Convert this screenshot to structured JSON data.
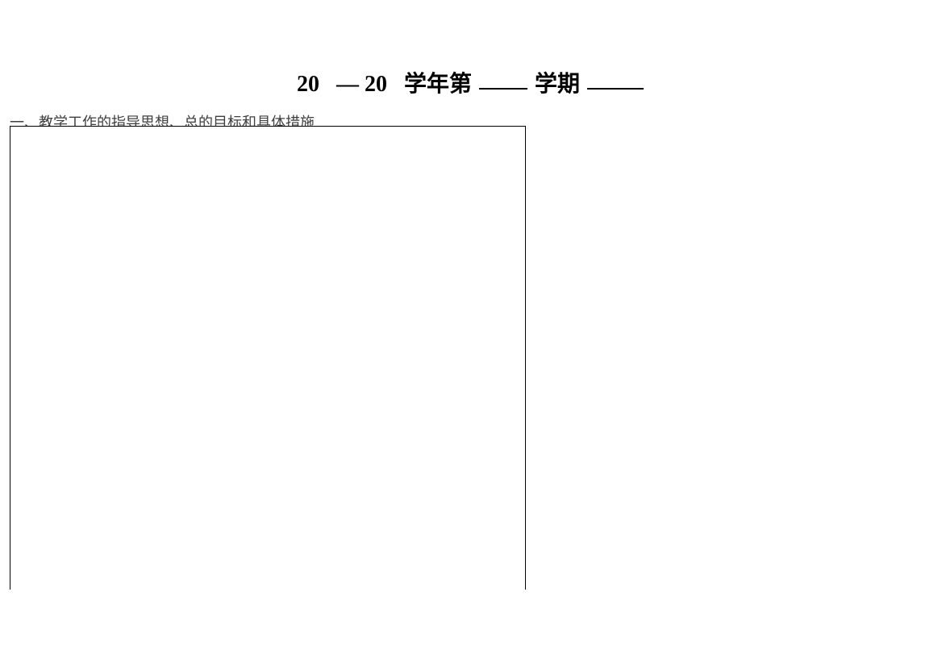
{
  "header": {
    "prefix1": "20",
    "dash": "—",
    "prefix2": "20",
    "text1": "学年第",
    "text2": "学期"
  },
  "section": {
    "label": "一、教学工作的指导思想、总的目标和具体措施"
  }
}
